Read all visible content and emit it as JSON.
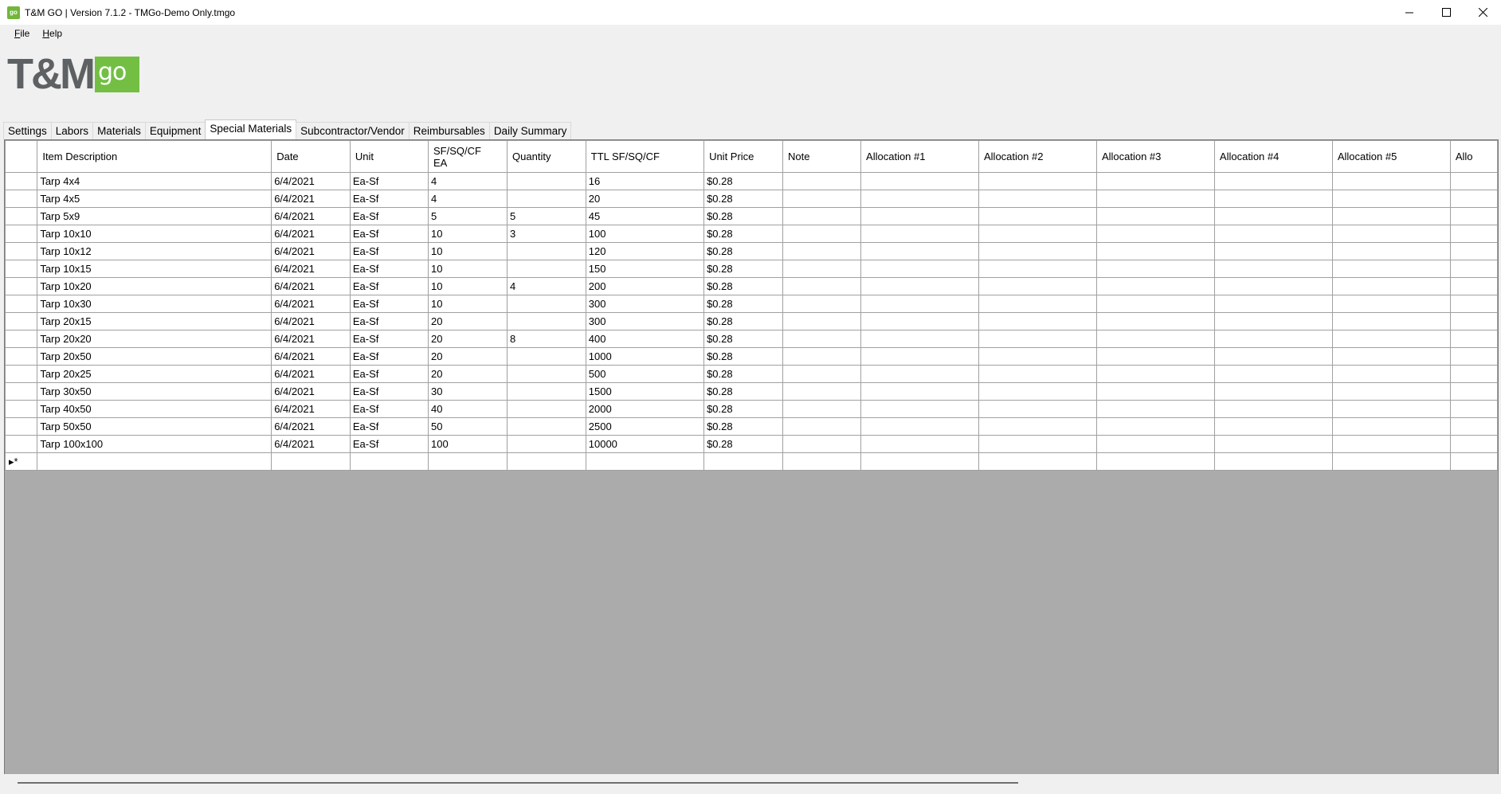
{
  "window": {
    "title": "T&M GO | Version 7.1.2 - TMGo-Demo Only.tmgo",
    "app_icon_text": "go"
  },
  "menu": [
    "File",
    "Help"
  ],
  "logo": {
    "text": "T&M",
    "badge": "go"
  },
  "tabs": [
    "Settings",
    "Labors",
    "Materials",
    "Equipment",
    "Special Materials",
    "Subcontractor/Vendor",
    "Reimbursables",
    "Daily Summary"
  ],
  "active_tab": "Special Materials",
  "grid": {
    "columns": [
      "Item Description",
      "Date",
      "Unit",
      "SF/SQ/CF EA",
      "Quantity",
      "TTL SF/SQ/CF",
      "Unit Price",
      "Note",
      "Allocation #1",
      "Allocation #2",
      "Allocation #3",
      "Allocation #4",
      "Allocation #5",
      "Allo"
    ],
    "rows": [
      [
        "Tarp 4x4",
        "6/4/2021",
        "Ea-Sf",
        "4",
        "",
        "16",
        "$0.28",
        "",
        "",
        "",
        "",
        "",
        "",
        ""
      ],
      [
        "Tarp 4x5",
        "6/4/2021",
        "Ea-Sf",
        "4",
        "",
        "20",
        "$0.28",
        "",
        "",
        "",
        "",
        "",
        "",
        ""
      ],
      [
        "Tarp 5x9",
        "6/4/2021",
        "Ea-Sf",
        "5",
        "5",
        "45",
        "$0.28",
        "",
        "",
        "",
        "",
        "",
        "",
        ""
      ],
      [
        "Tarp 10x10",
        "6/4/2021",
        "Ea-Sf",
        "10",
        "3",
        "100",
        "$0.28",
        "",
        "",
        "",
        "",
        "",
        "",
        ""
      ],
      [
        "Tarp 10x12",
        "6/4/2021",
        "Ea-Sf",
        "10",
        "",
        "120",
        "$0.28",
        "",
        "",
        "",
        "",
        "",
        "",
        ""
      ],
      [
        "Tarp 10x15",
        "6/4/2021",
        "Ea-Sf",
        "10",
        "",
        "150",
        "$0.28",
        "",
        "",
        "",
        "",
        "",
        "",
        ""
      ],
      [
        "Tarp 10x20",
        "6/4/2021",
        "Ea-Sf",
        "10",
        "4",
        "200",
        "$0.28",
        "",
        "",
        "",
        "",
        "",
        "",
        ""
      ],
      [
        "Tarp 10x30",
        "6/4/2021",
        "Ea-Sf",
        "10",
        "",
        "300",
        "$0.28",
        "",
        "",
        "",
        "",
        "",
        "",
        ""
      ],
      [
        "Tarp 20x15",
        "6/4/2021",
        "Ea-Sf",
        "20",
        "",
        "300",
        "$0.28",
        "",
        "",
        "",
        "",
        "",
        "",
        ""
      ],
      [
        "Tarp 20x20",
        "6/4/2021",
        "Ea-Sf",
        "20",
        "8",
        "400",
        "$0.28",
        "",
        "",
        "",
        "",
        "",
        "",
        ""
      ],
      [
        "Tarp 20x50",
        "6/4/2021",
        "Ea-Sf",
        "20",
        "",
        "1000",
        "$0.28",
        "",
        "",
        "",
        "",
        "",
        "",
        ""
      ],
      [
        "Tarp 20x25",
        "6/4/2021",
        "Ea-Sf",
        "20",
        "",
        "500",
        "$0.28",
        "",
        "",
        "",
        "",
        "",
        "",
        ""
      ],
      [
        "Tarp 30x50",
        "6/4/2021",
        "Ea-Sf",
        "30",
        "",
        "1500",
        "$0.28",
        "",
        "",
        "",
        "",
        "",
        "",
        ""
      ],
      [
        "Tarp 40x50",
        "6/4/2021",
        "Ea-Sf",
        "40",
        "",
        "2000",
        "$0.28",
        "",
        "",
        "",
        "",
        "",
        "",
        ""
      ],
      [
        "Tarp 50x50",
        "6/4/2021",
        "Ea-Sf",
        "50",
        "",
        "2500",
        "$0.28",
        "",
        "",
        "",
        "",
        "",
        "",
        ""
      ],
      [
        "Tarp 100x100",
        "6/4/2021",
        "Ea-Sf",
        "100",
        "",
        "10000",
        "$0.28",
        "",
        "",
        "",
        "",
        "",
        "",
        ""
      ]
    ],
    "new_row_marker": "▸*"
  }
}
